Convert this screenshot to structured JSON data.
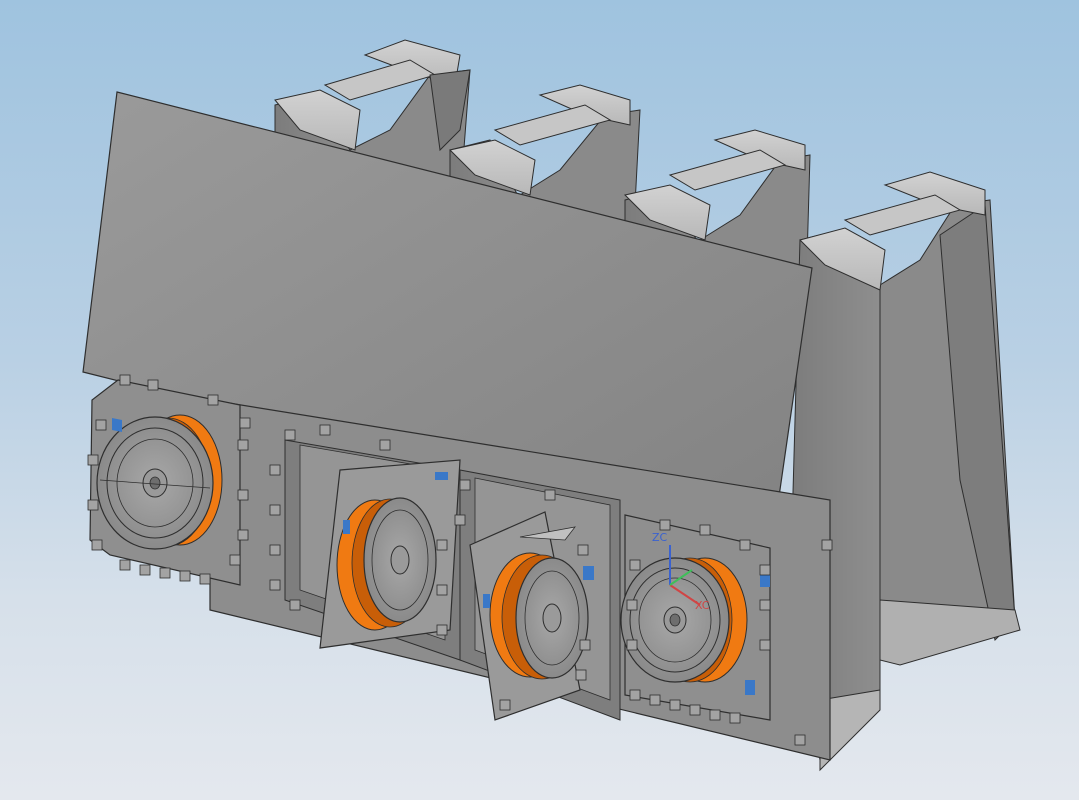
{
  "viewport": {
    "background_top": "#9fc3df",
    "background_bottom": "#e4e8ee"
  },
  "model": {
    "part_color": "#8c8c8c",
    "part_edge_color": "#2e2e2e",
    "ring_color": "#f07a12",
    "ring_shadow_color": "#c85e08",
    "hatch_color": "#3a78c8"
  },
  "csys": {
    "zc_label": "ZC",
    "xc_label": "XC",
    "z_color": "#3a62d0",
    "x_color": "#d04545",
    "y_color": "#3fbf5a"
  }
}
